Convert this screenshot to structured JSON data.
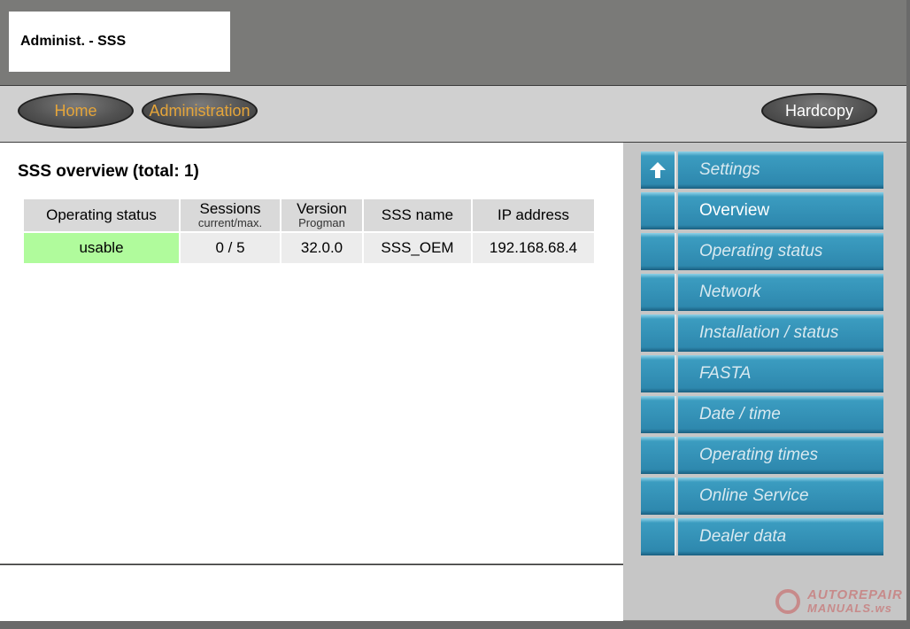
{
  "window": {
    "title": "Administ. - SSS"
  },
  "nav": {
    "home_label": "Home",
    "administration_label": "Administration",
    "hardcopy_label": "Hardcopy"
  },
  "overview": {
    "title": "SSS overview (total: 1)",
    "columns": [
      {
        "label": "Operating status",
        "sub": ""
      },
      {
        "label": "Sessions",
        "sub": "current/max."
      },
      {
        "label": "Version",
        "sub": "Progman"
      },
      {
        "label": "SSS name",
        "sub": ""
      },
      {
        "label": "IP address",
        "sub": ""
      }
    ],
    "rows": [
      [
        "usable",
        "0 / 5",
        "32.0.0",
        "SSS_OEM",
        "192.168.68.4"
      ]
    ],
    "status_color": "#b0fb9c"
  },
  "sidebar": {
    "items": [
      {
        "label": "Settings",
        "icon": "up-arrow-icon",
        "state": "inactive"
      },
      {
        "label": "Overview",
        "icon": "",
        "state": "active"
      },
      {
        "label": "Operating status",
        "icon": "",
        "state": "inactive"
      },
      {
        "label": "Network",
        "icon": "",
        "state": "inactive"
      },
      {
        "label": "Installation / status",
        "icon": "",
        "state": "inactive"
      },
      {
        "label": "FASTA",
        "icon": "",
        "state": "inactive"
      },
      {
        "label": "Date / time",
        "icon": "",
        "state": "inactive"
      },
      {
        "label": "Operating times",
        "icon": "",
        "state": "inactive"
      },
      {
        "label": "Online Service",
        "icon": "",
        "state": "inactive"
      },
      {
        "label": "Dealer data",
        "icon": "",
        "state": "inactive"
      }
    ]
  },
  "watermark": {
    "line1": "AUTOREPAIR",
    "line2": "MANUALS.ws"
  },
  "colors": {
    "accent_button_text": "#e5a53a",
    "menu_blue": "#2e88ae"
  }
}
